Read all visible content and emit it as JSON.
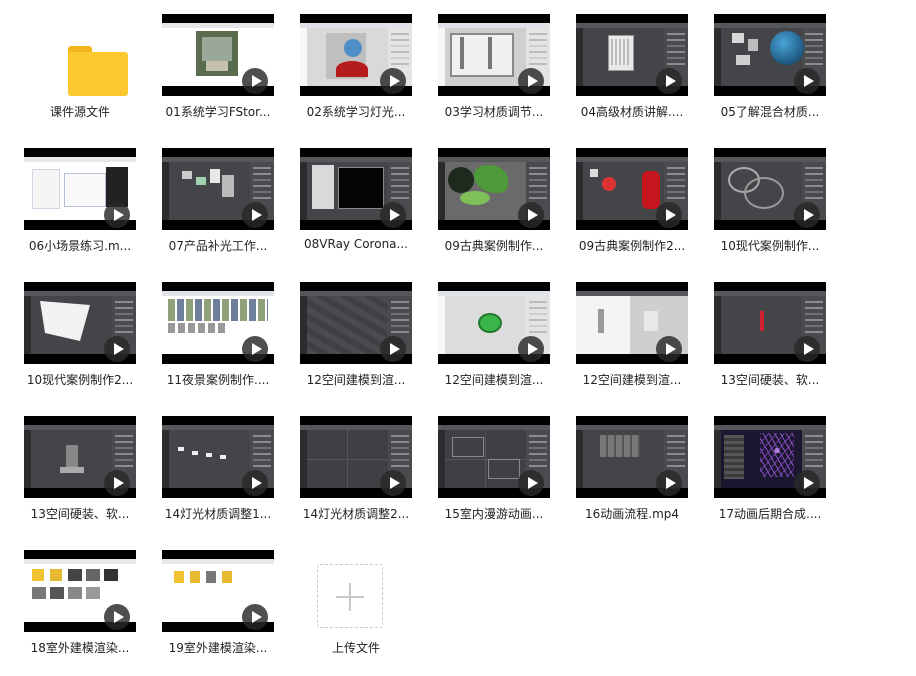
{
  "folder": {
    "name": "课件源文件",
    "icon": "folder-icon"
  },
  "files": [
    {
      "name": "01系统学习FStor...",
      "thumb": "photo"
    },
    {
      "name": "02系统学习灯光...",
      "thumb": "light"
    },
    {
      "name": "03学习材质调节...",
      "thumb": "light"
    },
    {
      "name": "04高级材质讲解....",
      "thumb": "dark"
    },
    {
      "name": "05了解混合材质...",
      "thumb": "dark"
    },
    {
      "name": "06小场景练习.m...",
      "thumb": "photo"
    },
    {
      "name": "07产品补光工作...",
      "thumb": "dark"
    },
    {
      "name": "08VRay Corona...",
      "thumb": "dark"
    },
    {
      "name": "09古典案例制作...",
      "thumb": "dark"
    },
    {
      "name": "09古典案例制作2...",
      "thumb": "dark"
    },
    {
      "name": "10现代案例制作...",
      "thumb": "dark"
    },
    {
      "name": "10现代案例制作2...",
      "thumb": "dark"
    },
    {
      "name": "11夜景案例制作....",
      "thumb": "light"
    },
    {
      "name": "12空间建模到渲...",
      "thumb": "dark"
    },
    {
      "name": "12空间建模到渲...",
      "thumb": "light"
    },
    {
      "name": "12空间建模到渲...",
      "thumb": "dark"
    },
    {
      "name": "13空间硬装、软...",
      "thumb": "dark"
    },
    {
      "name": "13空间硬装、软...",
      "thumb": "dark"
    },
    {
      "name": "14灯光材质调整1...",
      "thumb": "dark"
    },
    {
      "name": "14灯光材质调整2...",
      "thumb": "dark"
    },
    {
      "name": "15室内漫游动画...",
      "thumb": "dark"
    },
    {
      "name": "16动画流程.mp4",
      "thumb": "dark"
    },
    {
      "name": "17动画后期合成....",
      "thumb": "dark"
    },
    {
      "name": "18室外建模渲染...",
      "thumb": "photo"
    },
    {
      "name": "19室外建模渲染...",
      "thumb": "photo"
    }
  ],
  "upload": {
    "label": "上传文件",
    "icon": "plus-icon"
  },
  "colors": {
    "folder": "#fbc92f",
    "folder_tab": "#f1b51c",
    "text": "#222222",
    "play_overlay": "#282828"
  }
}
